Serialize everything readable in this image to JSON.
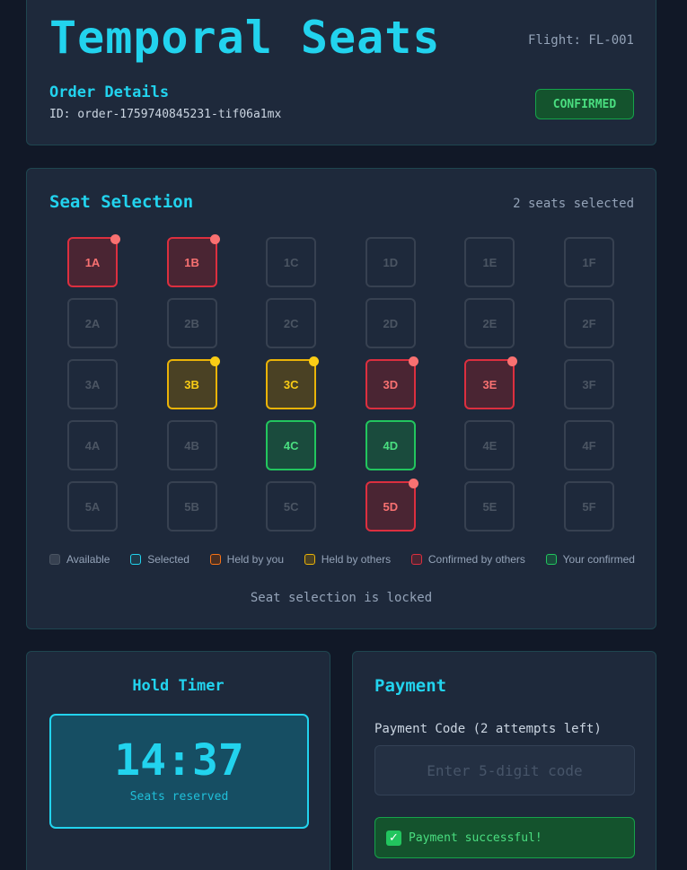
{
  "header": {
    "app_title": "Temporal Seats",
    "flight": "Flight: FL-001",
    "order_title": "Order Details",
    "order_id": "ID: order-1759740845231-tif06a1mx",
    "status": "CONFIRMED"
  },
  "seat_selection": {
    "title": "Seat Selection",
    "selected_count": "2 seats selected",
    "seats": [
      {
        "id": "1A",
        "state": "confirmed-by-others"
      },
      {
        "id": "1B",
        "state": "confirmed-by-others"
      },
      {
        "id": "1C",
        "state": "available"
      },
      {
        "id": "1D",
        "state": "available"
      },
      {
        "id": "1E",
        "state": "available"
      },
      {
        "id": "1F",
        "state": "available"
      },
      {
        "id": "2A",
        "state": "available"
      },
      {
        "id": "2B",
        "state": "available"
      },
      {
        "id": "2C",
        "state": "available"
      },
      {
        "id": "2D",
        "state": "available"
      },
      {
        "id": "2E",
        "state": "available"
      },
      {
        "id": "2F",
        "state": "available"
      },
      {
        "id": "3A",
        "state": "available"
      },
      {
        "id": "3B",
        "state": "held-by-others"
      },
      {
        "id": "3C",
        "state": "held-by-others"
      },
      {
        "id": "3D",
        "state": "confirmed-by-others"
      },
      {
        "id": "3E",
        "state": "confirmed-by-others"
      },
      {
        "id": "3F",
        "state": "available"
      },
      {
        "id": "4A",
        "state": "available"
      },
      {
        "id": "4B",
        "state": "available"
      },
      {
        "id": "4C",
        "state": "your-confirmed"
      },
      {
        "id": "4D",
        "state": "your-confirmed"
      },
      {
        "id": "4E",
        "state": "available"
      },
      {
        "id": "4F",
        "state": "available"
      },
      {
        "id": "5A",
        "state": "available"
      },
      {
        "id": "5B",
        "state": "available"
      },
      {
        "id": "5C",
        "state": "available"
      },
      {
        "id": "5D",
        "state": "confirmed-by-others"
      },
      {
        "id": "5E",
        "state": "available"
      },
      {
        "id": "5F",
        "state": "available"
      }
    ],
    "legend": [
      {
        "label": "Available",
        "color": "#4b5563",
        "fill": "#374151"
      },
      {
        "label": "Selected",
        "color": "#22d3ee",
        "fill": "#1e3a4a"
      },
      {
        "label": "Held by you",
        "color": "#f97316",
        "fill": "#4a2f22"
      },
      {
        "label": "Held by others",
        "color": "#eab308",
        "fill": "#4a4124"
      },
      {
        "label": "Confirmed by others",
        "color": "#dc2f3f",
        "fill": "#4a2533"
      },
      {
        "label": "Your confirmed",
        "color": "#22c55e",
        "fill": "#1a4b3d"
      }
    ],
    "locked_message": "Seat selection is locked"
  },
  "timer": {
    "title": "Hold Timer",
    "value": "14:37",
    "subtitle": "Seats reserved"
  },
  "payment": {
    "title": "Payment",
    "code_label": "Payment Code (2 attempts left)",
    "input_placeholder": "Enter 5-digit code",
    "input_value": "",
    "success_message": "Payment successful!",
    "success_icon": "check-mark-icon"
  },
  "colors": {
    "accent": "#22d3ee",
    "background": "#111827",
    "card": "#1e293b",
    "success": "#4ade80",
    "danger": "#f87171",
    "warning": "#facc15"
  }
}
